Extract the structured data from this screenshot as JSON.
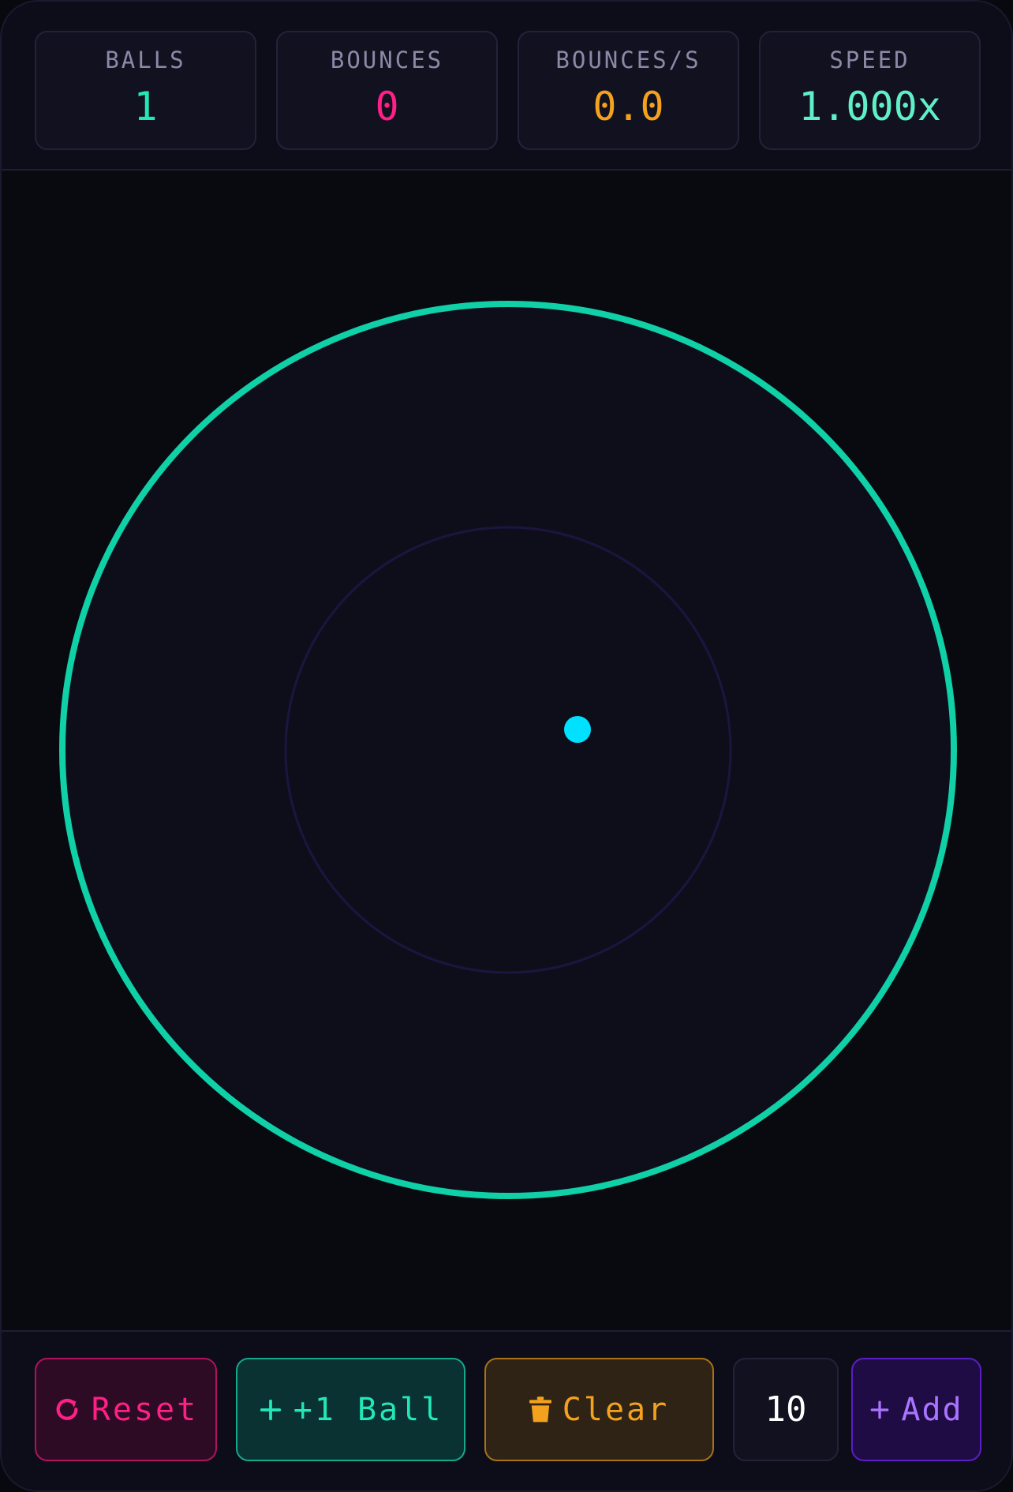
{
  "stats": [
    {
      "label": "BALLS",
      "value": "1",
      "color": "#22e8b8"
    },
    {
      "label": "BOUNCES",
      "value": "0",
      "color": "#ff1f86"
    },
    {
      "label": "BOUNCES/S",
      "value": "0.0",
      "color": "#f4a21e"
    },
    {
      "label": "SPEED",
      "value": "1.000x",
      "color": "#5ff0c8"
    }
  ],
  "arena": {
    "outer_ring_color": "#0fd0a6",
    "inner_ring_color": "#1d1440",
    "ball_color": "#00e0ff"
  },
  "controls": {
    "reset_label": "Reset",
    "reset_icon": "refresh-icon",
    "add_one_label": "+1 Ball",
    "add_one_icon": "plus-icon",
    "clear_label": "Clear",
    "clear_icon": "trash-icon",
    "count_value": "10",
    "add_label": "Add",
    "add_icon": "plus-icon"
  }
}
